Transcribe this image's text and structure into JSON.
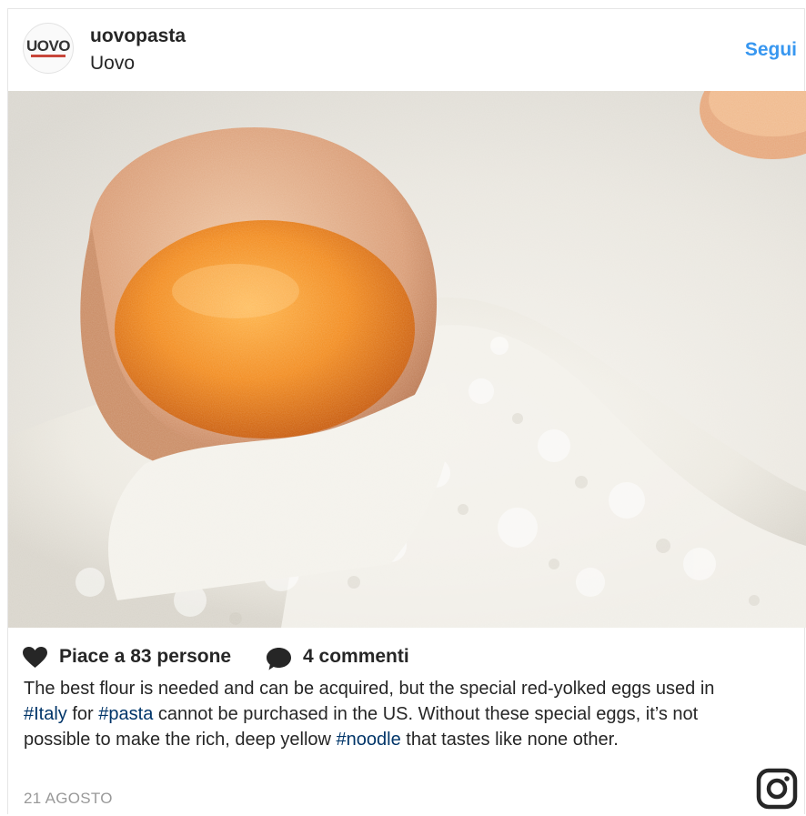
{
  "post": {
    "username": "uovopasta",
    "location": "Uovo",
    "follow_label": "Segui",
    "avatar_text": "UOVO",
    "likes_text": "Piace a 83 persone",
    "comments_text": "4 commenti",
    "caption": {
      "part1": "The best flour is needed and can be acquired, but the special red-yolked eggs used in ",
      "tag1": "#Italy",
      "part2": " for ",
      "tag2": "#pasta",
      "part3": " cannot be purchased in the US. Without these special eggs, it’s not possible to make the rich, deep yellow ",
      "tag3": "#noodle",
      "part4": " that tastes like none other."
    },
    "date": "21 AGOSTO"
  },
  "colors": {
    "link": "#3897f0",
    "hashtag": "#003569",
    "text": "#262626",
    "muted": "#999999"
  },
  "icons": {
    "like": "heart-icon",
    "comment": "speech-bubble-icon",
    "brand": "instagram-icon"
  }
}
